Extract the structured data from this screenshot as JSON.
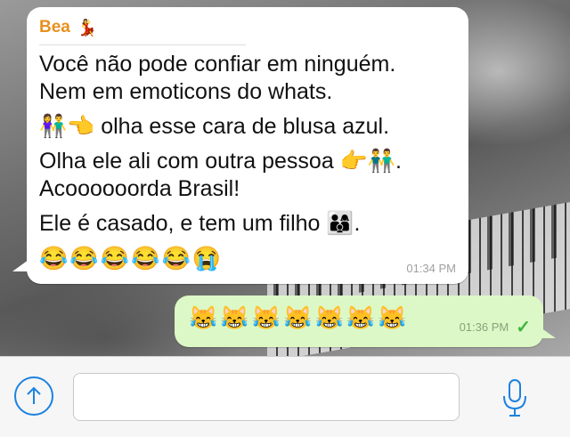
{
  "incoming": {
    "sender": "Bea",
    "sender_emoji": "💃",
    "lines": [
      "Você não pode confiar em ninguém.",
      "Nem em emoticons do whats.",
      "👫👈 olha esse cara de blusa azul.",
      "Olha ele ali com outra pessoa 👉👬.",
      "Acoooooorda Brasil!",
      "Ele é casado, e tem um filho 👨‍👩‍👦."
    ],
    "emojis": "😂😂😂😂😂😭",
    "time": "01:34 PM"
  },
  "outgoing": {
    "emojis": "😹😹😹😹😹😹😹",
    "time": "01:36 PM",
    "status": "✓"
  },
  "input": {
    "placeholder": ""
  },
  "colors": {
    "sender_name": "#e8901e",
    "outgoing_bubble": "#dcf8c6",
    "accent": "#1c82e0",
    "read_check": "#3fb63f"
  },
  "icons": {
    "upload": "upload-arrow-icon",
    "mic": "microphone-icon"
  }
}
